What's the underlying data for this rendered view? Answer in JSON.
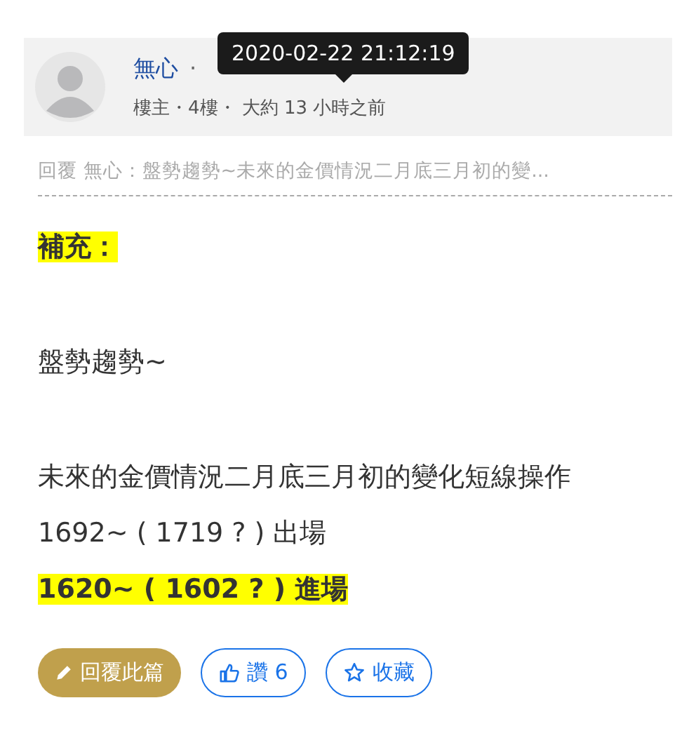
{
  "post": {
    "author": "無心",
    "separator": "·",
    "meta": "樓主・4樓・ 大約 13 小時之前",
    "tooltip": "2020-02-22 21:12:19"
  },
  "reply_quote": "回覆 無心：盤勢趨勢~未來的金價情況二月底三月初的變...",
  "content": [
    {
      "lines": [
        {
          "text": "補充：",
          "highlighted": true
        }
      ]
    },
    {
      "lines": [
        {
          "text": "盤勢趨勢~",
          "highlighted": false
        }
      ]
    },
    {
      "lines": [
        {
          "text": "未來的金價情況二月底三月初的變化短線操作",
          "highlighted": false
        },
        {
          "text": "1692~ ( 1719 ? ) 出場",
          "highlighted": false
        },
        {
          "text": "1620~ ( 1602 ? ) 進場",
          "highlighted": true
        }
      ]
    }
  ],
  "buttons": [
    {
      "kind": "reply",
      "label": "回覆此篇"
    },
    {
      "kind": "like",
      "label": "讚 6"
    },
    {
      "kind": "save",
      "label": "收藏"
    }
  ]
}
